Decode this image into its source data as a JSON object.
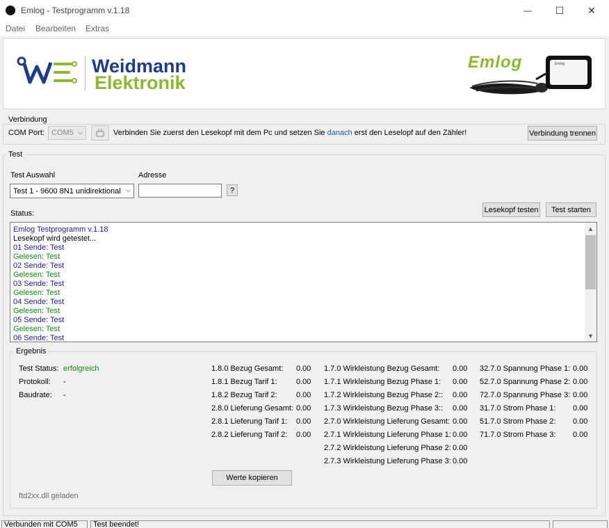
{
  "window": {
    "title": "Emlog - Testprogramm v.1.18",
    "minimize_glyph": "—",
    "maximize_glyph": "☐",
    "close_glyph": "✕"
  },
  "menu": [
    "Datei",
    "Bearbeiten",
    "Extras"
  ],
  "banner": {
    "company_line1": "Weidmann",
    "company_line2": "Elektronik",
    "product_logo": "Emlog",
    "device_label": "Emlog",
    "colors": {
      "blue": "#1e3b8f",
      "green": "#8dba2b"
    }
  },
  "verbindung": {
    "group_title": "Verbindung",
    "com_port_label": "COM Port:",
    "com_port_value": "COM5",
    "hint_before": "Verbinden Sie zuerst den Lesekopf mit dem Pc und setzen Sie ",
    "hint_link": "danach",
    "hint_after": " erst den Leselopf auf den Zähler!",
    "disconnect_button": "Verbindung trennen"
  },
  "test": {
    "group_title": "Test",
    "test_select_label": "Test Auswahl",
    "test_select_value": "Test 1 - 9600 8N1 unidirektional",
    "address_label": "Adresse",
    "address_value": "",
    "help_button": "?",
    "status_label": "Status:",
    "lesekopf_button": "Lesekopf testen",
    "start_button": "Test starten"
  },
  "log": [
    {
      "text": "Emlog Testprogramm v.1.18",
      "color": "#1a1aa6"
    },
    {
      "text": "Lesekopf wird getestet...",
      "color": "#000000"
    },
    {
      "text": "01 Sende: Test",
      "color": "#1a1aa6"
    },
    {
      "text": "Gelesen: Test",
      "color": "#138a13"
    },
    {
      "text": "02 Sende: Test",
      "color": "#1a1aa6"
    },
    {
      "text": "Gelesen: Test",
      "color": "#138a13"
    },
    {
      "text": "03 Sende: Test",
      "color": "#1a1aa6"
    },
    {
      "text": "Gelesen: Test",
      "color": "#138a13"
    },
    {
      "text": "04 Sende: Test",
      "color": "#1a1aa6"
    },
    {
      "text": "Gelesen: Test",
      "color": "#138a13"
    },
    {
      "text": "05 Sende: Test",
      "color": "#1a1aa6"
    },
    {
      "text": "Gelesen: Test",
      "color": "#138a13"
    },
    {
      "text": "06 Sende: Test",
      "color": "#1a1aa6"
    }
  ],
  "ergebnis": {
    "group_title": "Ergebnis",
    "test_status_label": "Test Status:",
    "test_status_value": "erfolgreich",
    "test_status_color": "#138a13",
    "protokoll_label": "Protokoll:",
    "protokoll_value": "-",
    "baudrate_label": "Baudrate:",
    "baudrate_value": "-",
    "col1": [
      {
        "label": "1.8.0 Bezug Gesamt:",
        "value": "0.00"
      },
      {
        "label": "1.8.1 Bezug Tarif 1:",
        "value": "0.00"
      },
      {
        "label": "1.8.2 Bezug Tarif 2:",
        "value": "0.00"
      },
      {
        "label": "2.8.0 Lieferung Gesamt:",
        "value": "0.00"
      },
      {
        "label": "2.8.1 Lieferung Tarif 1:",
        "value": "0.00"
      },
      {
        "label": "2.8.2 Lieferung Tarif 2:",
        "value": "0.00"
      }
    ],
    "col2": [
      {
        "label": "1.7.0 Wirkleistung Bezug Gesamt:",
        "value": "0.00"
      },
      {
        "label": "1.7.1 Wirkleistung Bezug Phase 1:",
        "value": "0.00"
      },
      {
        "label": "1.7.2 Wirkleistung Bezug Phase 2::",
        "value": "0.00"
      },
      {
        "label": "1.7.3 Wirkleistung Bezug Phase 3::",
        "value": "0.00"
      },
      {
        "label": "2.7.0 Wirkleistung Lieferung Gesamt:",
        "value": "0.00"
      },
      {
        "label": "2.7.1 Wirkleistung Lieferung Phase 1:",
        "value": "0.00"
      },
      {
        "label": "2.7.2 Wirkleistung Lieferung Phase 2:",
        "value": "0.00"
      },
      {
        "label": "2.7.3 Wirkleistung Lieferung Phase 3:",
        "value": "0.00"
      }
    ],
    "col3": [
      {
        "label": "32.7.0 Spannung Phase 1:",
        "value": "0.00"
      },
      {
        "label": "52.7.0 Spannung Phase 2:",
        "value": "0.00"
      },
      {
        "label": "72.7.0 Spannung Phase 3:",
        "value": "0.00"
      },
      {
        "label": "31.7.0 Strom Phase 1:",
        "value": "0.00"
      },
      {
        "label": "51.7.0 Strom Phase 2:",
        "value": "0.00"
      },
      {
        "label": "71.7.0 Strom Phase 3:",
        "value": "0.00"
      }
    ],
    "copy_button": "Werte kopieren",
    "dll_status": "ftd2xx.dll geladen"
  },
  "statusbar": {
    "connection": "Verbunden mit COM5",
    "state": "Test beendet!"
  }
}
